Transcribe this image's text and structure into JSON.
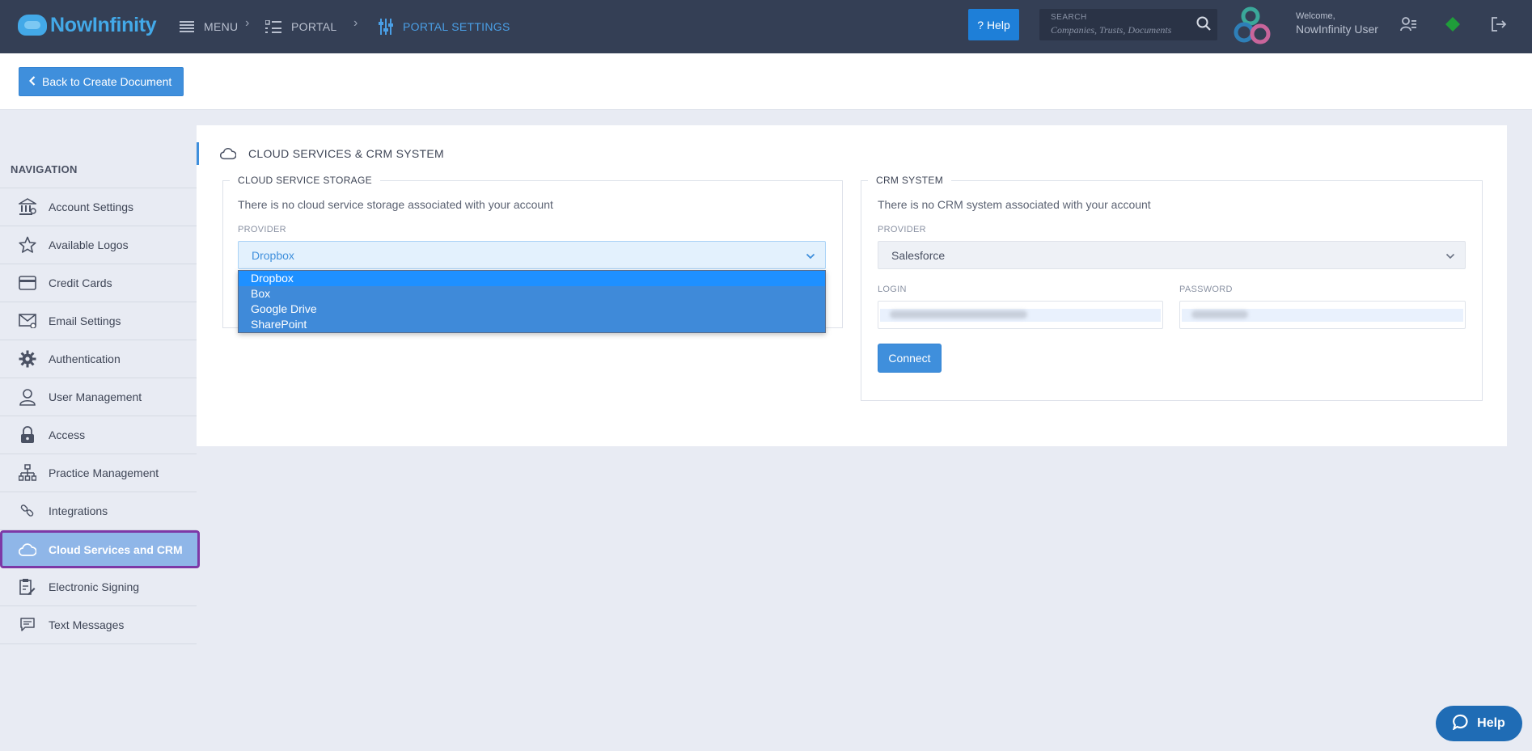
{
  "app": {
    "brand_now": "Now",
    "brand_infinity": "Infinity"
  },
  "breadcrumb": {
    "menu": "MENU",
    "portal": "PORTAL",
    "portal_settings": "PORTAL SETTINGS"
  },
  "header": {
    "help_label": "? Help",
    "search_label": "SEARCH",
    "search_placeholder": "Companies, Trusts, Documents",
    "welcome": "Welcome,",
    "user_name": "NowInfinity User"
  },
  "subheader": {
    "back_label": "Back to Create Document"
  },
  "sidebar": {
    "heading": "NAVIGATION",
    "items": [
      {
        "label": "Account Settings",
        "icon": "bank-icon"
      },
      {
        "label": "Available Logos",
        "icon": "star-icon"
      },
      {
        "label": "Credit Cards",
        "icon": "credit-card-icon"
      },
      {
        "label": "Email Settings",
        "icon": "email-icon"
      },
      {
        "label": "Authentication",
        "icon": "gear-icon"
      },
      {
        "label": "User Management",
        "icon": "user-icon"
      },
      {
        "label": "Access",
        "icon": "lock-icon"
      },
      {
        "label": "Practice Management",
        "icon": "org-chart-icon"
      },
      {
        "label": "Integrations",
        "icon": "link-icon"
      },
      {
        "label": "Cloud Services and CRM",
        "icon": "cloud-icon",
        "active": true
      },
      {
        "label": "Electronic Signing",
        "icon": "signing-icon"
      },
      {
        "label": "Text Messages",
        "icon": "message-icon"
      }
    ]
  },
  "main": {
    "title": "CLOUD SERVICES & CRM SYSTEM",
    "cloud": {
      "legend": "CLOUD SERVICE STORAGE",
      "info": "There is no cloud service storage associated with your account",
      "provider_label": "PROVIDER",
      "provider_value": "Dropbox",
      "options": [
        "Dropbox",
        "Box",
        "Google Drive",
        "SharePoint"
      ],
      "highlighted_option": "Dropbox"
    },
    "crm": {
      "legend": "CRM SYSTEM",
      "info": "There is no CRM system associated with your account",
      "provider_label": "PROVIDER",
      "provider_value": "Salesforce",
      "login_label": "LOGIN",
      "password_label": "PASSWORD",
      "connect_label": "Connect"
    }
  },
  "help_widget": {
    "label": "Help"
  },
  "colors": {
    "topbar": "#343f55",
    "accent": "#3f8fdc",
    "active_nav": "#8fb6e8",
    "active_outline": "#7d38a6"
  }
}
